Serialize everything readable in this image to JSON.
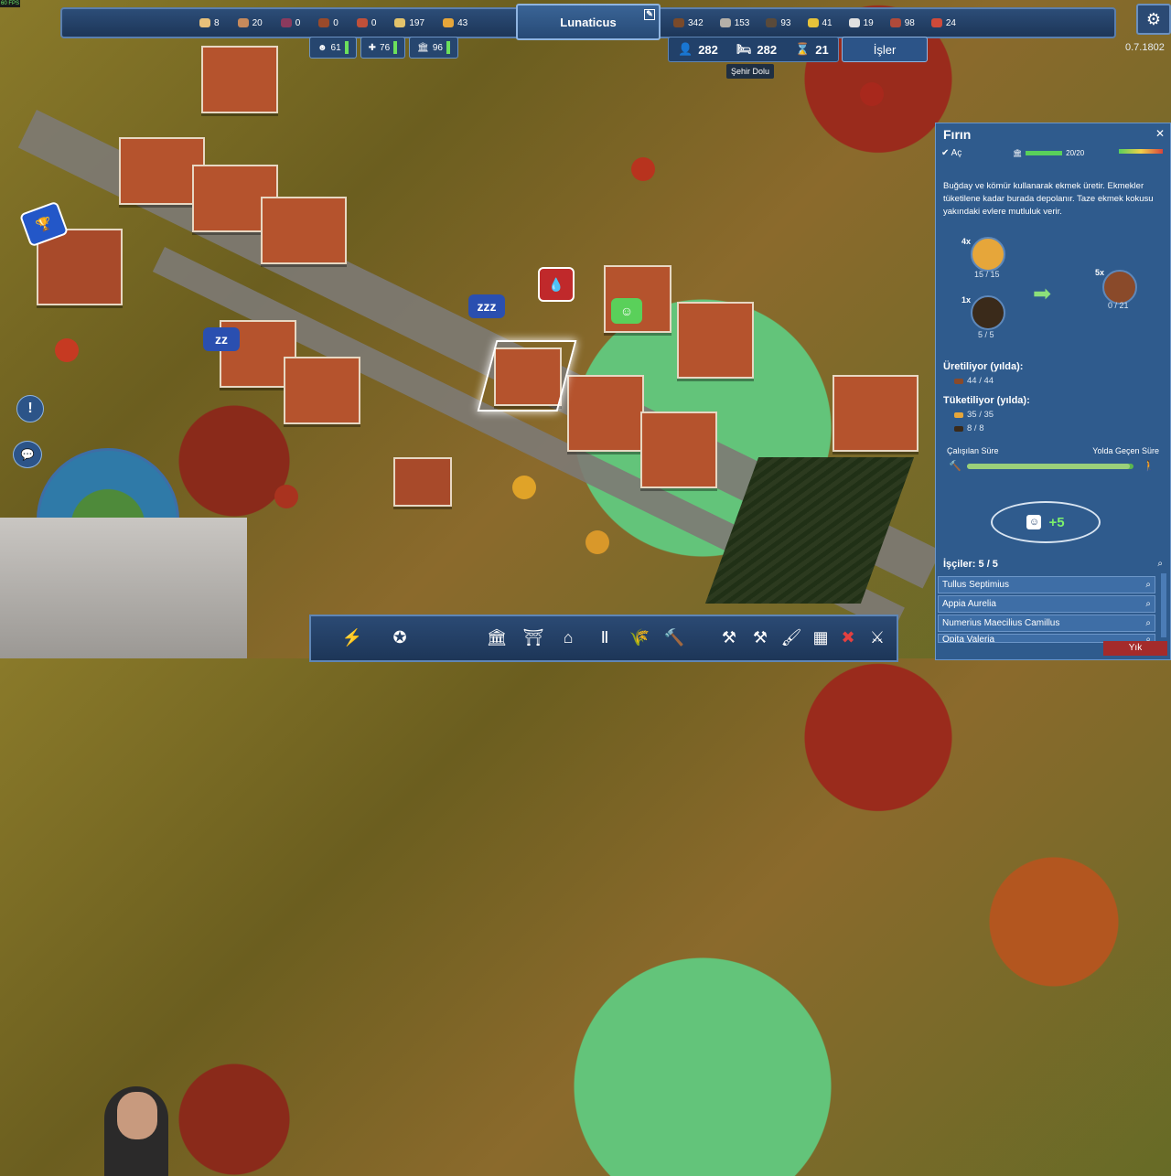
{
  "fps": "60 FPS",
  "resources_left": [
    {
      "name": "bread-icon",
      "value": "8",
      "color": "#e8c07a"
    },
    {
      "name": "pottery-icon",
      "value": "20",
      "color": "#c68a5c"
    },
    {
      "name": "grapes-icon",
      "value": "0",
      "color": "#8c3a5e"
    },
    {
      "name": "clay-icon",
      "value": "0",
      "color": "#9a4a2a"
    },
    {
      "name": "fish-icon",
      "value": "0",
      "color": "#c0503a"
    },
    {
      "name": "wheat-icon",
      "value": "197",
      "color": "#e3c36b"
    },
    {
      "name": "bread-loaf-icon",
      "value": "43",
      "color": "#e6a63a"
    }
  ],
  "resources_right": [
    {
      "name": "wood-icon",
      "value": "342",
      "color": "#7a4a2a"
    },
    {
      "name": "stone-icon",
      "value": "153",
      "color": "#b5b0a8"
    },
    {
      "name": "coal-icon",
      "value": "93",
      "color": "#5a4a3a"
    },
    {
      "name": "gold-icon",
      "value": "41",
      "color": "#e6c23a"
    },
    {
      "name": "marble-icon",
      "value": "19",
      "color": "#e0e0e0"
    },
    {
      "name": "meat-icon",
      "value": "98",
      "color": "#b04a3a"
    },
    {
      "name": "tools-icon",
      "value": "24",
      "color": "#d04a3a"
    }
  ],
  "city_name": "Lunaticus",
  "version": "0.7.1802",
  "stats": [
    {
      "name": "happiness-stat",
      "value": "61"
    },
    {
      "name": "health-stat",
      "value": "76"
    },
    {
      "name": "culture-stat",
      "value": "96"
    }
  ],
  "population": {
    "people": "282",
    "housing": "282",
    "workers": "21"
  },
  "jobs_button": "İşler",
  "tooltip": "Şehir Dolu",
  "panel": {
    "title": "Fırın",
    "open_label": "Aç",
    "capacity": "20/20",
    "capacity_fill": 1.0,
    "description": "Buğday ve kömür kullanarak ekmek üretir. Ekmekler tüketilene kadar burada depolanır. Taze ekmek kokusu yakındaki evlere mutluluk verir.",
    "input1": {
      "mult": "4x",
      "count": "15 / 15"
    },
    "input2": {
      "mult": "1x",
      "count": "5 / 5"
    },
    "output": {
      "mult": "5x",
      "count": "0 / 21"
    },
    "producing_label": "Üretiliyor (yılda):",
    "producing_value": "44 / 44",
    "consuming_label": "Tüketiliyor (yılda):",
    "consuming_values": [
      "35 / 35",
      "8 / 8"
    ],
    "work_time_label": "Çalışılan Süre",
    "travel_time_label": "Yolda Geçen Süre",
    "work_fraction": 0.98,
    "happiness_bonus": "+5",
    "workers_label": "İşçiler: 5 / 5",
    "workers": [
      "Tullus Septimius",
      "Appia Aurelia",
      "Numerius Maecilius Camillus",
      "Opita Valeria"
    ],
    "demolish": "Yık"
  }
}
